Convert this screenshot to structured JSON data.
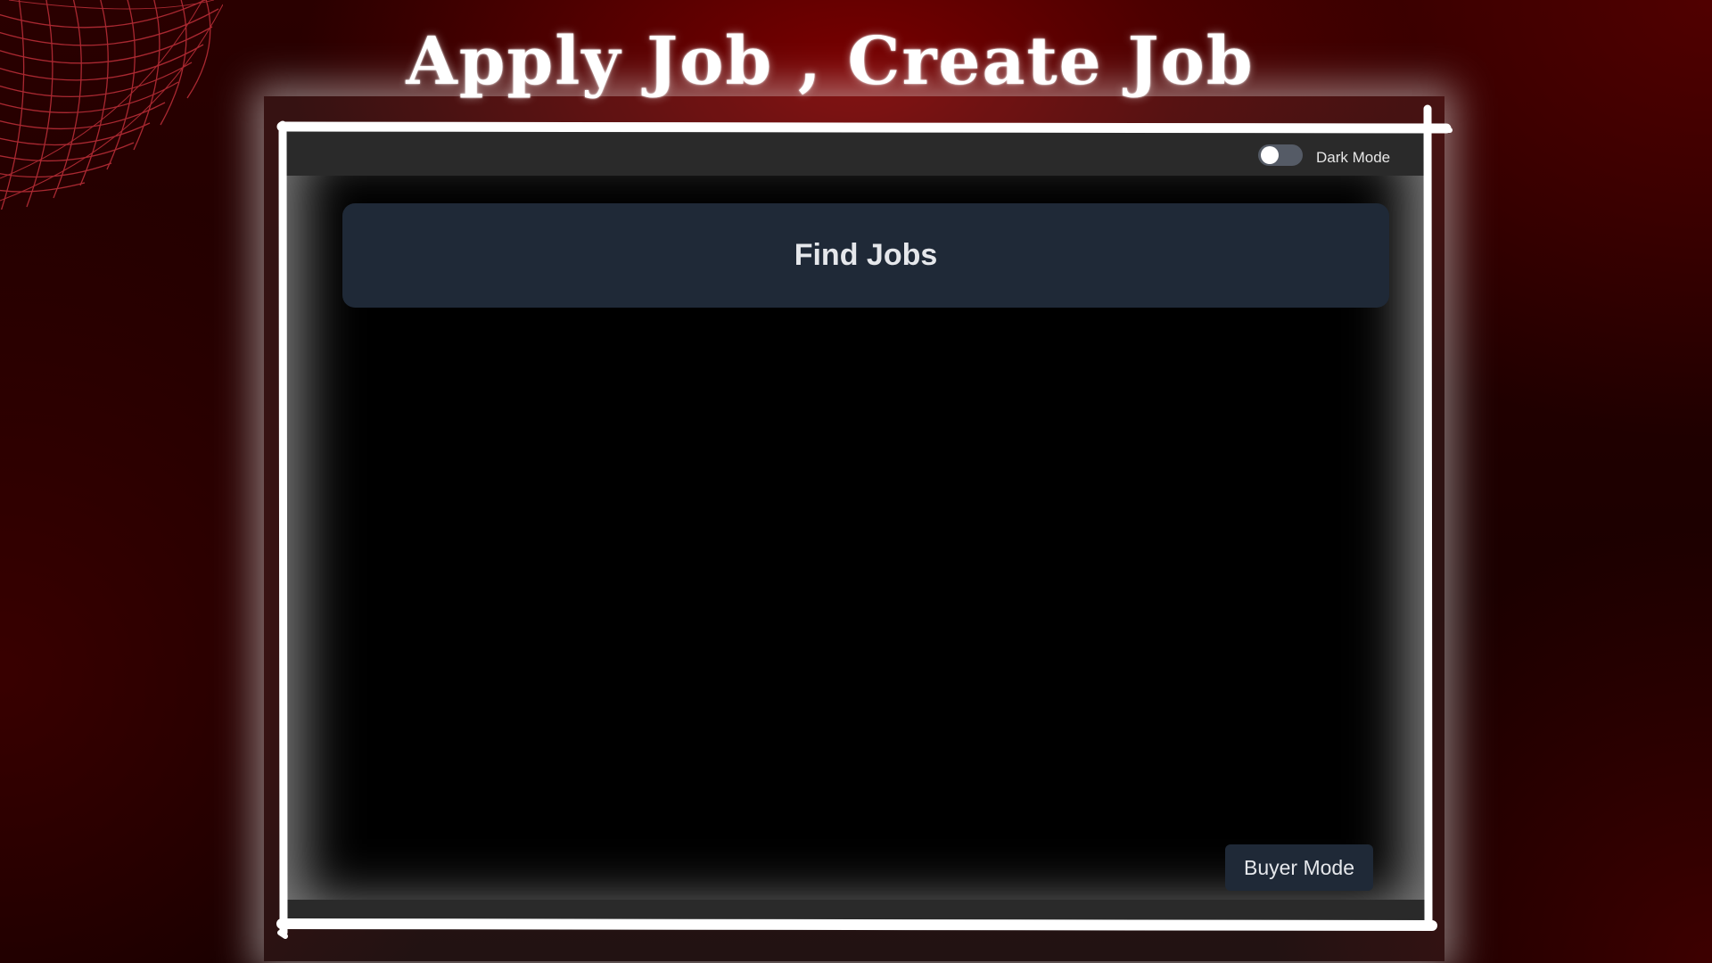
{
  "headline": "Apply Job , Create Job",
  "app": {
    "header": {
      "dark_mode_label": "Dark Mode",
      "dark_mode_on": false
    },
    "find_jobs_label": "Find Jobs",
    "buyer_mode_label": "Buyer Mode"
  },
  "colors": {
    "background": "#1a0000",
    "accent_red": "#c0303a",
    "app_surface": "#000000",
    "card": "#1f2937",
    "text": "#e5e7eb"
  },
  "icons": {
    "decor": "wireframe-sphere-icon",
    "toggle": "toggle-switch-icon"
  }
}
